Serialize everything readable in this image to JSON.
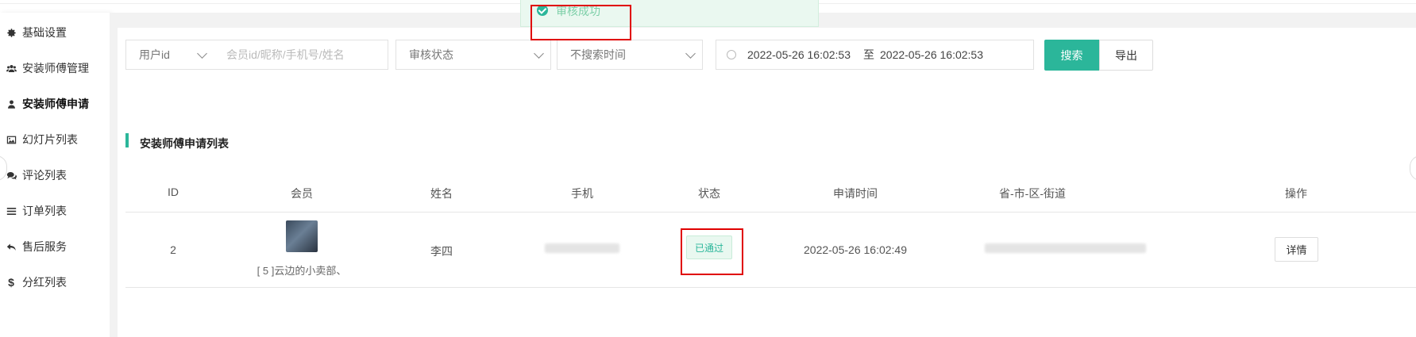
{
  "toast": {
    "message": "审核成功"
  },
  "sidebar": {
    "items": [
      {
        "label": "基础设置",
        "icon": "gear-icon"
      },
      {
        "label": "安装师傅管理",
        "icon": "users-icon"
      },
      {
        "label": "安装师傅申请",
        "icon": "user-icon"
      },
      {
        "label": "幻灯片列表",
        "icon": "image-icon"
      },
      {
        "label": "评论列表",
        "icon": "comments-icon"
      },
      {
        "label": "订单列表",
        "icon": "list-icon"
      },
      {
        "label": "售后服务",
        "icon": "reply-icon"
      },
      {
        "label": "分红列表",
        "icon": "dollar-icon"
      }
    ],
    "active_index": 2
  },
  "search": {
    "field_select": "用户id",
    "keyword_placeholder": "会员id/昵称/手机号/姓名",
    "status_select": "审核状态",
    "time_select": "不搜索时间",
    "date_start": "2022-05-26 16:02:53",
    "date_sep": "至",
    "date_end": "2022-05-26 16:02:53",
    "search_label": "搜索",
    "export_label": "导出"
  },
  "list": {
    "title": "安装师傅申请列表",
    "columns": [
      "ID",
      "会员",
      "姓名",
      "手机",
      "状态",
      "申请时间",
      "省-市-区-街道",
      "操作"
    ],
    "rows": [
      {
        "id": "2",
        "member_name": "[ 5 ]云边的小卖部、",
        "real_name": "李四",
        "status": "已通过",
        "apply_time": "2022-05-26 16:02:49",
        "action": "详情"
      }
    ]
  },
  "colors": {
    "accent": "#2bb69a",
    "highlight": "#e00000"
  }
}
